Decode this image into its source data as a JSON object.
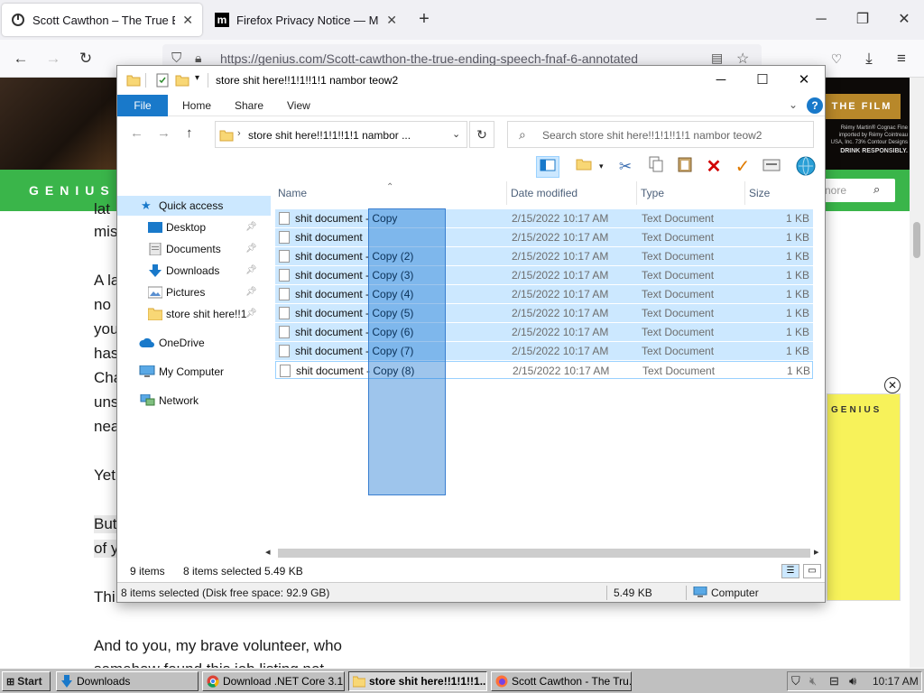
{
  "browser": {
    "tabs": [
      {
        "title": "Scott Cawthon – The True Endin"
      },
      {
        "title": "Firefox Privacy Notice — Mozill"
      }
    ],
    "url": "https://genius.com/Scott-cawthon-the-true-ending-speech-fnaf-6-annotated"
  },
  "page": {
    "banner": {
      "film": "THE FILM",
      "fine_print": "Rémy Martin® Cognac Fine imported by Rémy Cointreau USA, Inc. 73% Contour Designs",
      "drink": "DRINK RESPONSIBLY."
    },
    "logo": "GENIUS",
    "search_placeholder": "nore",
    "lines": [
      "lat",
      "mis",
      "A la",
      "no",
      "you",
      "has",
      "Cha",
      "uns",
      "nea",
      "Yet",
      "But",
      "of y",
      "Thi",
      "And to you, my brave volunteer, who",
      "somehow found this job listing not"
    ],
    "ad_logo": "GENIUS"
  },
  "explorer": {
    "title": "store shit here!!1!1!!1!1 nambor teow2",
    "ribbon": [
      "File",
      "Home",
      "Share",
      "View"
    ],
    "address": "store shit here!!1!1!!1!1 nambor ...",
    "search_placeholder": "Search store shit here!!1!1!!1!1 nambor teow2",
    "nav": {
      "quick_access": "Quick access",
      "items": [
        "Desktop",
        "Documents",
        "Downloads",
        "Pictures",
        "store shit here!!1"
      ],
      "onedrive": "OneDrive",
      "computer": "My Computer",
      "network": "Network"
    },
    "columns": [
      "Name",
      "Date modified",
      "Type",
      "Size"
    ],
    "files": [
      {
        "name": "shit document - Copy",
        "date": "2/15/2022 10:17 AM",
        "type": "Text Document",
        "size": "1 KB"
      },
      {
        "name": "shit document",
        "date": "2/15/2022 10:17 AM",
        "type": "Text Document",
        "size": "1 KB"
      },
      {
        "name": "shit document - Copy (2)",
        "date": "2/15/2022 10:17 AM",
        "type": "Text Document",
        "size": "1 KB"
      },
      {
        "name": "shit document - Copy (3)",
        "date": "2/15/2022 10:17 AM",
        "type": "Text Document",
        "size": "1 KB"
      },
      {
        "name": "shit document - Copy (4)",
        "date": "2/15/2022 10:17 AM",
        "type": "Text Document",
        "size": "1 KB"
      },
      {
        "name": "shit document - Copy (5)",
        "date": "2/15/2022 10:17 AM",
        "type": "Text Document",
        "size": "1 KB"
      },
      {
        "name": "shit document - Copy (6)",
        "date": "2/15/2022 10:17 AM",
        "type": "Text Document",
        "size": "1 KB"
      },
      {
        "name": "shit document - Copy (7)",
        "date": "2/15/2022 10:17 AM",
        "type": "Text Document",
        "size": "1 KB"
      },
      {
        "name": "shit document - Copy (8)",
        "date": "2/15/2022 10:17 AM",
        "type": "Text Document",
        "size": "1 KB"
      }
    ],
    "status": {
      "count": "9 items",
      "selected": "8 items selected",
      "size": "5.49 KB"
    },
    "status2": {
      "selected": "8 items selected (Disk free space: 92.9 GB)",
      "size": "5.49 KB",
      "location": "Computer"
    }
  },
  "taskbar": {
    "start": "Start",
    "buttons": [
      "Downloads",
      "Download .NET Core 3.1...",
      "store shit here!!1!1!!1...",
      "Scott Cawthon - The Tru..."
    ],
    "clock": "10:17 AM"
  },
  "colors": {
    "genius_green": "#3ab54a",
    "selection": "#cce8ff",
    "file_tab": "#1979ca"
  }
}
